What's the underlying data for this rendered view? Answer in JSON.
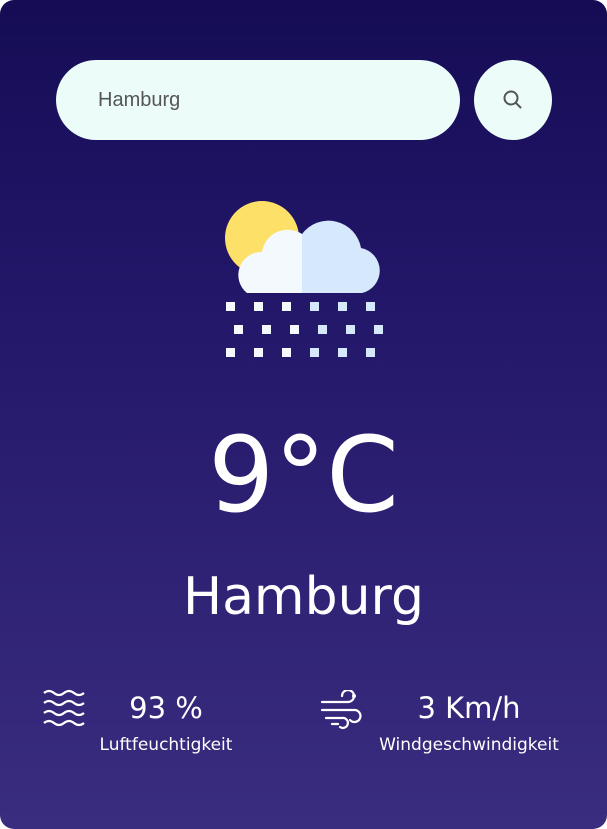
{
  "search": {
    "value": "Hamburg",
    "button_icon": "search-icon"
  },
  "weather": {
    "icon": "snow-sun-cloud-icon",
    "temperature": "9°C",
    "city": "Hamburg"
  },
  "humidity": {
    "icon": "humidity-waves-icon",
    "value": "93 %",
    "label": "Luftfeuchtigkeit"
  },
  "wind": {
    "icon": "wind-icon",
    "value": "3 Km/h",
    "label": "Windgeschwindigkeit"
  },
  "colors": {
    "background_top": "#150c55",
    "background_bottom": "#3a2d80",
    "field": "#ecfdf9",
    "sun": "#fde068",
    "cloud_light": "#f4f9fd",
    "cloud_shade": "#d6e8fb"
  }
}
